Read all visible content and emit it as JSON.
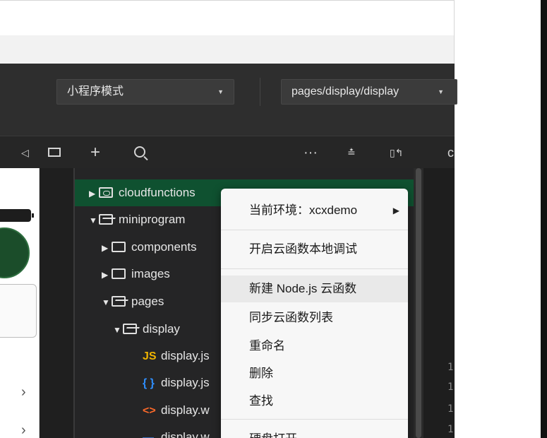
{
  "toolbar": {
    "mode_select": "小程序模式",
    "page_select": "pages/display/display"
  },
  "explorer_toolbar": {
    "add_icon": "plus-icon",
    "search_icon": "search-icon",
    "more_icon": "more-icon",
    "editor_letter": "c"
  },
  "tree": {
    "items": [
      {
        "label": "cloudfunctions",
        "type": "cloud-folder",
        "expanded": false
      },
      {
        "label": "miniprogram",
        "type": "folder",
        "expanded": true
      },
      {
        "label": "components",
        "type": "folder",
        "expanded": false
      },
      {
        "label": "images",
        "type": "folder",
        "expanded": false
      },
      {
        "label": "pages",
        "type": "folder",
        "expanded": true
      },
      {
        "label": "display",
        "type": "folder",
        "expanded": true
      },
      {
        "label": "display.js",
        "prefix": "JS",
        "type": "file"
      },
      {
        "label": "display.js",
        "prefix": "{ }",
        "type": "file"
      },
      {
        "label": "display.w",
        "prefix": "<>",
        "type": "file"
      },
      {
        "label": "display.w",
        "prefix": "",
        "type": "file"
      }
    ]
  },
  "context_menu": {
    "items": [
      {
        "label": "当前环境：xcxdemo"
      },
      {
        "label": "开启云函数本地调试"
      },
      {
        "label": "新建 Node.js 云函数"
      },
      {
        "label": "同步云函数列表"
      },
      {
        "label": "重命名"
      },
      {
        "label": "删除"
      },
      {
        "label": "查找"
      },
      {
        "label": "硬盘打开"
      }
    ]
  },
  "editor": {
    "line_numbers": [
      "1",
      "1",
      "1",
      "1"
    ]
  },
  "colors": {
    "toolbar_bg": "#2e2e2e",
    "tree_bg": "#252526",
    "selected_row": "#0f5130",
    "js_icon": "#f0b400",
    "json_icon": "#2f8fff",
    "wxml_icon": "#ff6a2a",
    "wxss_icon": "#3b7dd8"
  }
}
